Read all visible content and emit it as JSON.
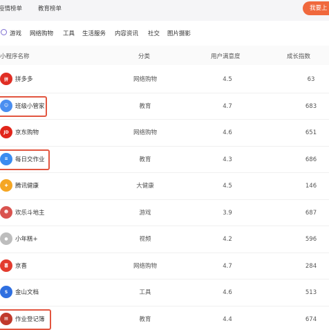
{
  "top_tabs": [
    "疫情榜单",
    "教育榜单"
  ],
  "cta_label": "我要上",
  "categories": [
    "游戏",
    "网络购物",
    "工具",
    "生活服务",
    "内容资讯",
    "社交",
    "图片摄影"
  ],
  "table": {
    "headers": [
      "小程序名称",
      "分类",
      "用户满意度",
      "成长指数"
    ],
    "rows": [
      {
        "name": "拼多多",
        "category": "网络购物",
        "satisfaction": "4.5",
        "growth": "63",
        "icon": "pinduoduo-icon",
        "color": "#e02e24",
        "highlight": false
      },
      {
        "name": "班级小管家",
        "category": "教育",
        "satisfaction": "4.7",
        "growth": "683",
        "icon": "class-manager-icon",
        "color": "#4a8ef0",
        "highlight": true
      },
      {
        "name": "京东购物",
        "category": "网络购物",
        "satisfaction": "4.6",
        "growth": "651",
        "icon": "jd-icon",
        "color": "#e1251b",
        "highlight": false
      },
      {
        "name": "每日交作业",
        "category": "教育",
        "satisfaction": "4.3",
        "growth": "686",
        "icon": "homework-icon",
        "color": "#3b8cf0",
        "highlight": true
      },
      {
        "name": "腾讯健康",
        "category": "大健康",
        "satisfaction": "4.5",
        "growth": "146",
        "icon": "tencent-health-icon",
        "color": "#f5a623",
        "highlight": false
      },
      {
        "name": "欢乐斗地主",
        "category": "游戏",
        "satisfaction": "3.9",
        "growth": "687",
        "icon": "doudizhu-icon",
        "color": "#d9534f",
        "highlight": false
      },
      {
        "name": "小年糕+",
        "category": "视频",
        "satisfaction": "4.2",
        "growth": "596",
        "icon": "xiaoniangao-icon",
        "color": "#bdbdbd",
        "highlight": false
      },
      {
        "name": "京喜",
        "category": "网络购物",
        "satisfaction": "4.7",
        "growth": "284",
        "icon": "jingxi-icon",
        "color": "#e33b2e",
        "highlight": false
      },
      {
        "name": "金山文档",
        "category": "工具",
        "satisfaction": "4.6",
        "growth": "513",
        "icon": "kingsoft-docs-icon",
        "color": "#2f6fe0",
        "highlight": false
      },
      {
        "name": "作业登记簿",
        "category": "教育",
        "satisfaction": "4.4",
        "growth": "674",
        "icon": "homework-register-icon",
        "color": "#c0392b",
        "highlight": true
      }
    ]
  }
}
